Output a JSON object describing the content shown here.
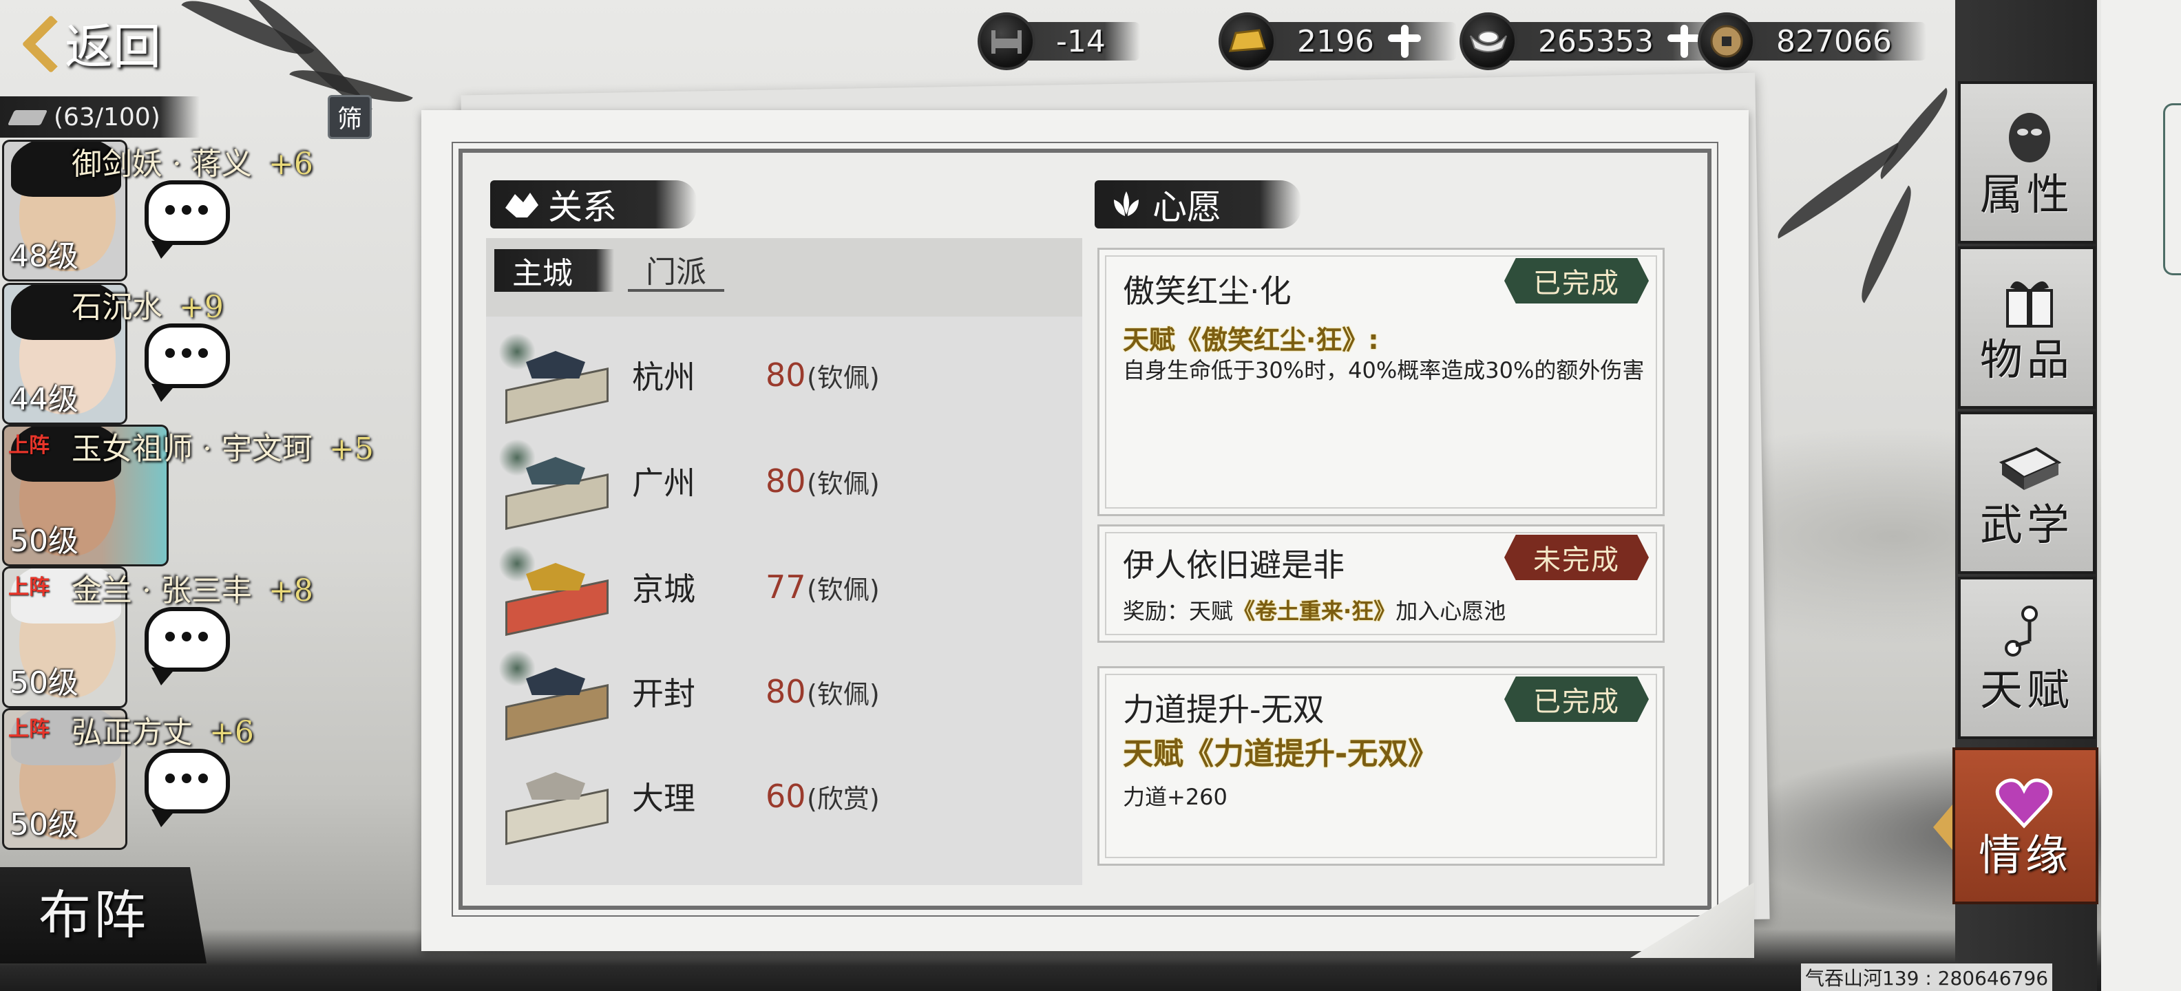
{
  "header": {
    "back_label": "返回"
  },
  "currencies": [
    {
      "icon": "bed-icon",
      "value": "-14",
      "has_plus": false
    },
    {
      "icon": "gold-ingot-icon",
      "value": "2196",
      "has_plus": true
    },
    {
      "icon": "silver-ingot-icon",
      "value": "265353",
      "has_plus": true
    },
    {
      "icon": "copper-coin-icon",
      "value": "827066",
      "has_plus": false
    }
  ],
  "roster": {
    "count": "(63/100)",
    "filter_label": "筛",
    "heroes": [
      {
        "name": "御剑妖 · 蒋义",
        "bonus": "+6",
        "level": "48级",
        "on_field": false,
        "on_field_tag": ""
      },
      {
        "name": "石沉水",
        "bonus": "+9",
        "level": "44级",
        "on_field": false,
        "on_field_tag": ""
      },
      {
        "name": "玉女祖师 · 宇文珂",
        "bonus": "+5",
        "level": "50级",
        "on_field": true,
        "on_field_tag": "上阵"
      },
      {
        "name": "金兰 · 张三丰",
        "bonus": "+8",
        "level": "50级",
        "on_field": true,
        "on_field_tag": "上阵"
      },
      {
        "name": "弘正方丈",
        "bonus": "+6",
        "level": "50级",
        "on_field": true,
        "on_field_tag": "上阵"
      }
    ],
    "formation_label": "布阵"
  },
  "relations": {
    "title": "关系",
    "tabs": [
      {
        "label": "主城",
        "active": true
      },
      {
        "label": "门派",
        "active": false
      }
    ],
    "cities": [
      {
        "name": "杭州",
        "value": "80",
        "state": "(钦佩)"
      },
      {
        "name": "广州",
        "value": "80",
        "state": "(钦佩)"
      },
      {
        "name": "京城",
        "value": "77",
        "state": "(钦佩)"
      },
      {
        "name": "开封",
        "value": "80",
        "state": "(钦佩)"
      },
      {
        "name": "大理",
        "value": "60",
        "state": "(欣赏)"
      }
    ]
  },
  "wishes": {
    "title": "心愿",
    "items": [
      {
        "title": "傲笑红尘·化",
        "status": "已完成",
        "talent": "天赋《傲笑红尘·狂》:",
        "desc": "自身生命低于30%时，40%概率造成30%的额外伤害"
      },
      {
        "title": "伊人依旧避是非",
        "status": "未完成",
        "reward_prefix": "奖励：天赋",
        "reward_talent": "《卷土重来·狂》",
        "reward_suffix": "加入心愿池"
      },
      {
        "title": "力道提升-无双",
        "status": "已完成",
        "talent": "天赋《力道提升-无双》",
        "desc": "力道+260"
      }
    ]
  },
  "side_menu": [
    {
      "label": "属性",
      "icon": "mask-icon",
      "active": false
    },
    {
      "label": "物品",
      "icon": "gift-box-icon",
      "active": false
    },
    {
      "label": "武学",
      "icon": "book-icon",
      "active": false
    },
    {
      "label": "天赋",
      "icon": "talent-node-icon",
      "active": false
    },
    {
      "label": "情缘",
      "icon": "heart-icon",
      "active": true
    }
  ],
  "watermark": "气吞山河139 : 280646796"
}
